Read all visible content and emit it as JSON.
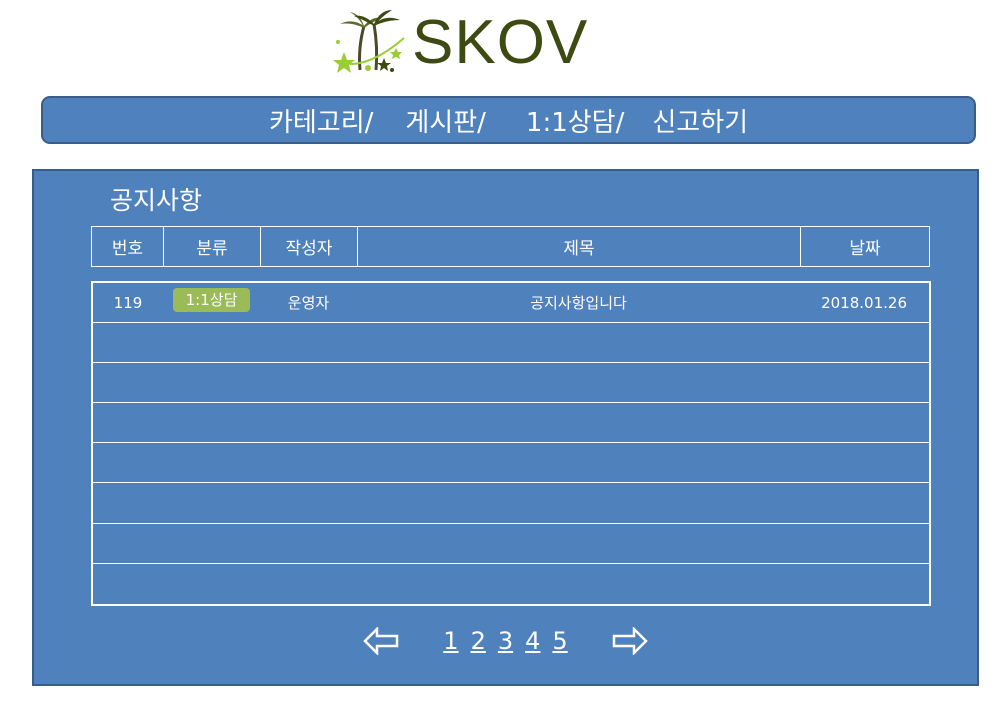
{
  "logo": {
    "text": "SKOV"
  },
  "nav": {
    "items": [
      "카테고리/",
      "게시판/",
      "1:1상담/",
      "신고하기"
    ]
  },
  "board": {
    "title": "공지사항",
    "headers": [
      "번호",
      "분류",
      "작성자",
      "제목",
      "날짜"
    ],
    "rows": [
      {
        "number": "119",
        "category": "1:1상담",
        "author": "운영자",
        "subject": "공지사항입니다",
        "date": "2018.01.26"
      }
    ]
  },
  "pagination": {
    "pages": [
      "1",
      "2",
      "3",
      "4",
      "5"
    ]
  },
  "colors": {
    "primary": "#4f81bd",
    "border": "#385d8a",
    "badge": "#9bbb59",
    "logo_text": "#3d4a12"
  }
}
